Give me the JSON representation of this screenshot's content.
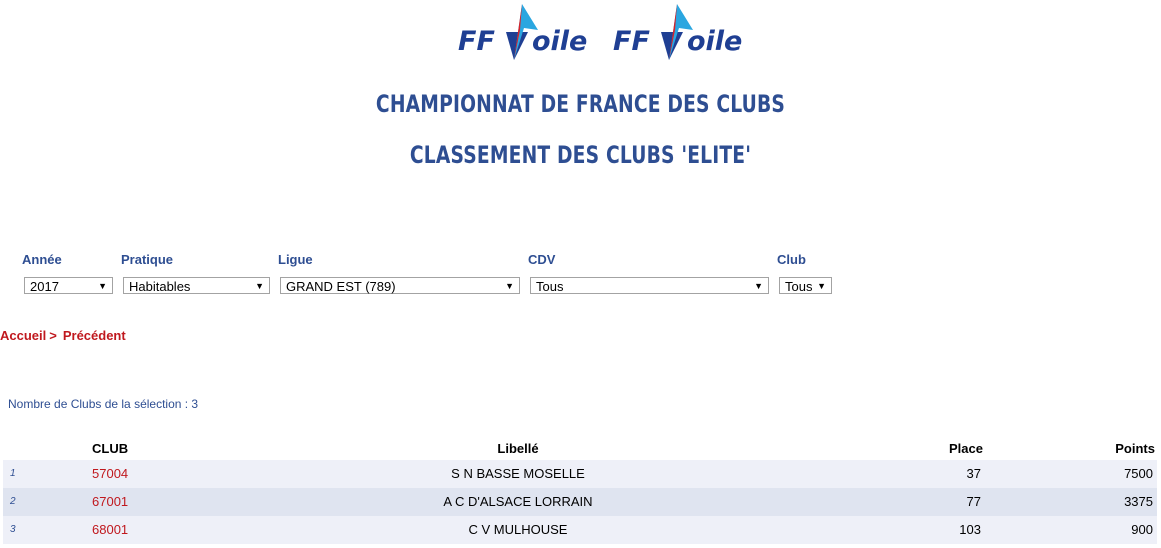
{
  "logos": [
    {
      "text": "FF Voile"
    },
    {
      "text": "FF Voile"
    }
  ],
  "header": {
    "title1": "CHAMPIONNAT DE FRANCE DES CLUBS",
    "title2": "CLASSEMENT DES CLUBS 'ELITE'"
  },
  "filters": {
    "annee": {
      "label": "Année",
      "value": "2017"
    },
    "pratique": {
      "label": "Pratique",
      "value": "Habitables"
    },
    "ligue": {
      "label": "Ligue",
      "value": "GRAND EST (789)"
    },
    "cdv": {
      "label": "CDV",
      "value": "Tous"
    },
    "club": {
      "label": "Club",
      "value": "Tous"
    }
  },
  "breadcrumb": {
    "home": "Accueil",
    "sep": ">",
    "prev": "Précédent"
  },
  "count_text": "Nombre de Clubs de la sélection : 3",
  "table": {
    "headers": {
      "club": "CLUB",
      "libelle": "Libellé",
      "place": "Place",
      "points": "Points"
    },
    "rows": [
      {
        "idx": "1",
        "club": "57004",
        "libelle": "S N BASSE MOSELLE",
        "place": "37",
        "points": "7500"
      },
      {
        "idx": "2",
        "club": "67001",
        "libelle": "A C D'ALSACE LORRAIN",
        "place": "77",
        "points": "3375"
      },
      {
        "idx": "3",
        "club": "68001",
        "libelle": "C V MULHOUSE",
        "place": "103",
        "points": "900"
      }
    ]
  },
  "colors": {
    "accent": "#2e4e92",
    "link": "#c0181e",
    "row_odd": "#eef0f8",
    "row_even": "#dfe4f0"
  }
}
